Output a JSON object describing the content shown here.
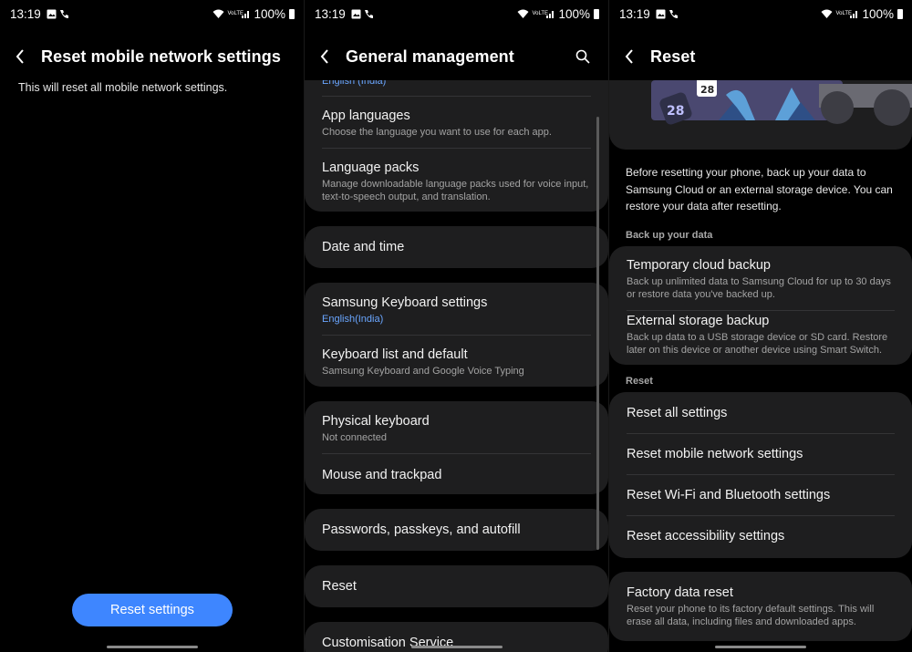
{
  "status_bar": {
    "time": "13:19",
    "battery": "100%",
    "network": "VoLTE"
  },
  "panel1": {
    "title": "Reset mobile network settings",
    "description": "This will reset all mobile network settings.",
    "button": "Reset settings"
  },
  "panel2": {
    "title": "General management",
    "partial_top_sub": "English (India)",
    "groups": [
      {
        "items": [
          {
            "title": "App languages",
            "subtitle": "Choose the language you want to use for each app."
          },
          {
            "title": "Language packs",
            "subtitle": "Manage downloadable language packs used for voice input, text-to-speech output, and translation."
          }
        ]
      },
      {
        "items": [
          {
            "title": "Date and time"
          }
        ]
      },
      {
        "items": [
          {
            "title": "Samsung Keyboard settings",
            "subtitle": "English(India)"
          },
          {
            "title": "Keyboard list and default",
            "subtitle": "Samsung Keyboard and Google Voice Typing"
          }
        ]
      },
      {
        "items": [
          {
            "title": "Physical keyboard",
            "subtitle": "Not connected"
          },
          {
            "title": "Mouse and trackpad"
          }
        ]
      },
      {
        "items": [
          {
            "title": "Passwords, passkeys, and autofill"
          }
        ]
      },
      {
        "items": [
          {
            "title": "Reset"
          }
        ]
      },
      {
        "items": [
          {
            "title": "Customisation Service"
          }
        ]
      }
    ]
  },
  "panel3": {
    "title": "Reset",
    "banner_date": "28",
    "intro": "Before resetting your phone, back up your data to Samsung Cloud or an external storage device. You can restore your data after resetting.",
    "section_backup": "Back up your data",
    "backup_items": [
      {
        "title": "Temporary cloud backup",
        "subtitle": "Back up unlimited data to Samsung Cloud for up to 30 days or restore data you've backed up."
      },
      {
        "title": "External storage backup",
        "subtitle": "Back up data to a USB storage device or SD card. Restore later on this device or another device using Smart Switch."
      }
    ],
    "section_reset": "Reset",
    "reset_items": [
      {
        "title": "Reset all settings"
      },
      {
        "title": "Reset mobile network settings"
      },
      {
        "title": "Reset Wi-Fi and Bluetooth settings"
      },
      {
        "title": "Reset accessibility settings"
      }
    ],
    "factory": {
      "title": "Factory data reset",
      "subtitle": "Reset your phone to its factory default settings. This will erase all data, including files and downloaded apps."
    }
  },
  "colors": {
    "background": "#000000",
    "card": "#1e1e1f",
    "accent": "#3e86ff",
    "link_blue": "#6aa6ff"
  }
}
